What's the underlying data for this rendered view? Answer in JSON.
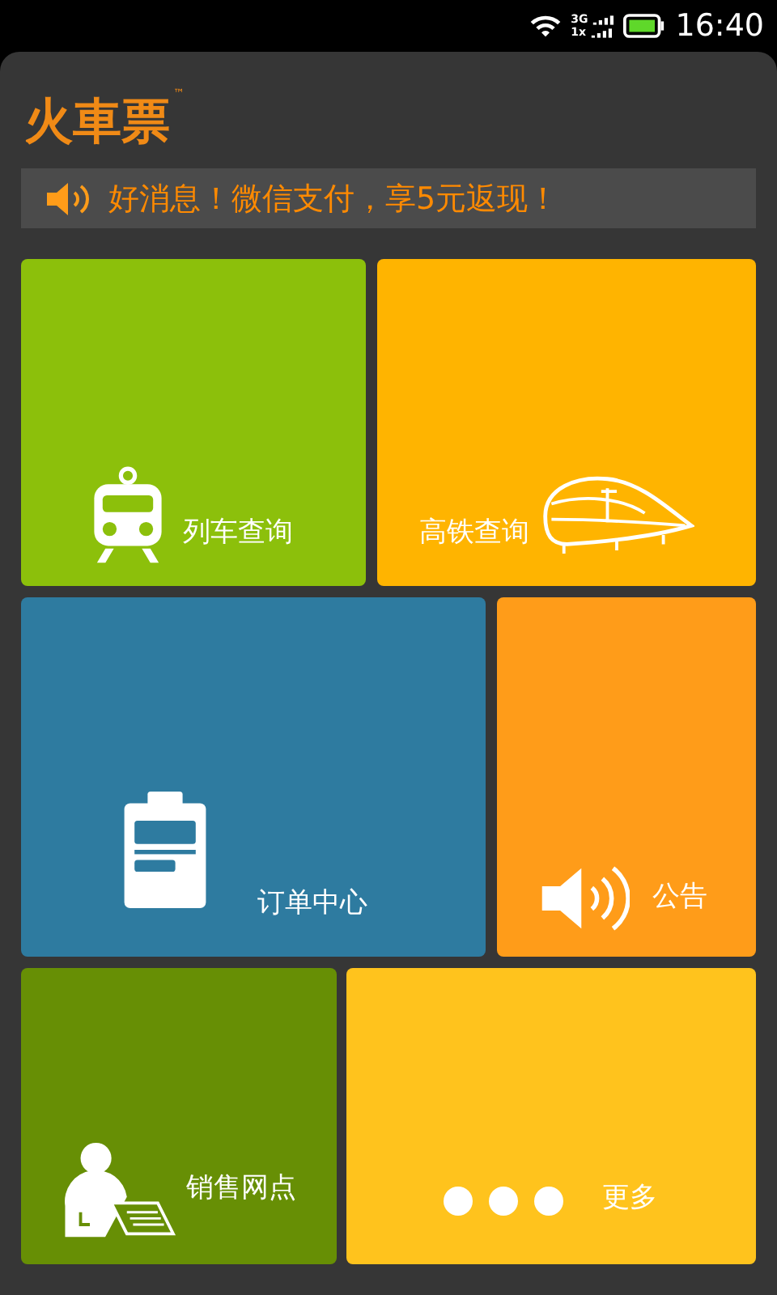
{
  "status_bar": {
    "network_top": "3G",
    "network_bottom": "1x",
    "time": "16:40"
  },
  "logo": {
    "text": "火車票",
    "mark": "™"
  },
  "notice": {
    "text": "好消息！微信支付，享5元返现！"
  },
  "tiles": [
    {
      "kind": "train",
      "label": "列车查询",
      "color": "#8cc00b"
    },
    {
      "kind": "bullet",
      "label": "高铁查询",
      "color": "#ffb400"
    },
    {
      "kind": "order",
      "label": "订单中心",
      "color": "#2e7ba0"
    },
    {
      "kind": "speaker",
      "label": "公告",
      "color": "#ff9c19"
    },
    {
      "kind": "agent",
      "label": "销售网点",
      "color": "#678f05"
    },
    {
      "kind": "more",
      "label": "更多",
      "color": "#ffc31d"
    }
  ]
}
